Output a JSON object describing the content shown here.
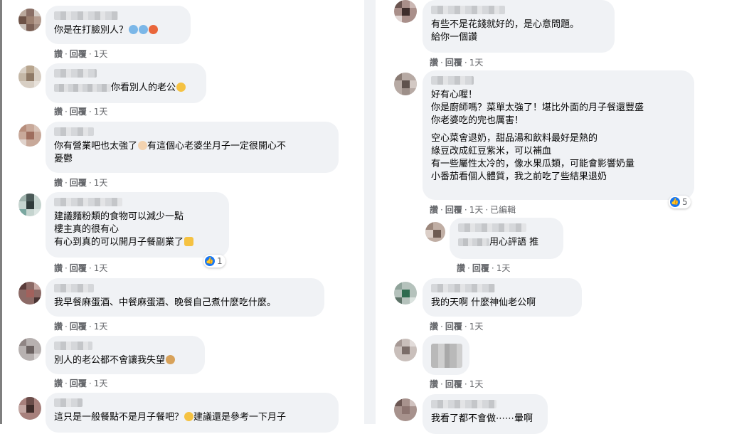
{
  "actions": {
    "like": "讚",
    "reply": "回覆",
    "sep": "·",
    "time": "1天",
    "edited": "已編輯"
  },
  "left": [
    {
      "lines": [
        "你是在打臉別人？"
      ]
    },
    {
      "lines": [
        "你看別人的老公"
      ]
    },
    {
      "lines": [
        "你有營業吧也太強了",
        "有這個心老婆坐月子一定很開心不",
        "憂鬱"
      ]
    },
    {
      "lines": [
        "建議麵粉類的食物可以減少一點",
        "樓主真的很有心",
        "有心到真的可以開月子餐副業了"
      ],
      "reactions": "1"
    },
    {
      "lines": [
        "我早餐麻蛋酒、中餐麻蛋酒、晚餐自己煮什麼吃什麼。"
      ]
    },
    {
      "lines": [
        "別人的老公都不會讓我失望"
      ]
    },
    {
      "lines": [
        "這只是一般餐點不是月子餐吧？",
        "建議還是參考一下月子"
      ]
    }
  ],
  "right": [
    {
      "lines": [
        "有些不是花錢就好的，是心意問題。",
        "給你一個讚"
      ]
    },
    {
      "lines": [
        "好有心喔！",
        "你是廚師嗎？菜單太強了！堪比外面的月子餐還豐盛",
        "你老婆吃的完也厲害！",
        "空心菜會退奶，甜品湯和飲料最好是熱的",
        "綠豆改成紅豆紫米，可以補血",
        "有一些屬性太冷的，像水果瓜類，可能會影響奶量",
        "小番茄看個人體質，我之前吃了些結果退奶"
      ],
      "reactions": "5"
    },
    {
      "lines": [
        "用心評語 推"
      ]
    },
    {
      "lines": [
        "我的天啊 什麼神仙老公啊"
      ]
    },
    {
      "lines": []
    },
    {
      "lines": [
        "我看了都不會做⋯⋯暈啊"
      ]
    }
  ],
  "colors": {
    "bubble": "#f0f2f5",
    "meta": "#65676b",
    "like_blue": "#1877f2"
  }
}
